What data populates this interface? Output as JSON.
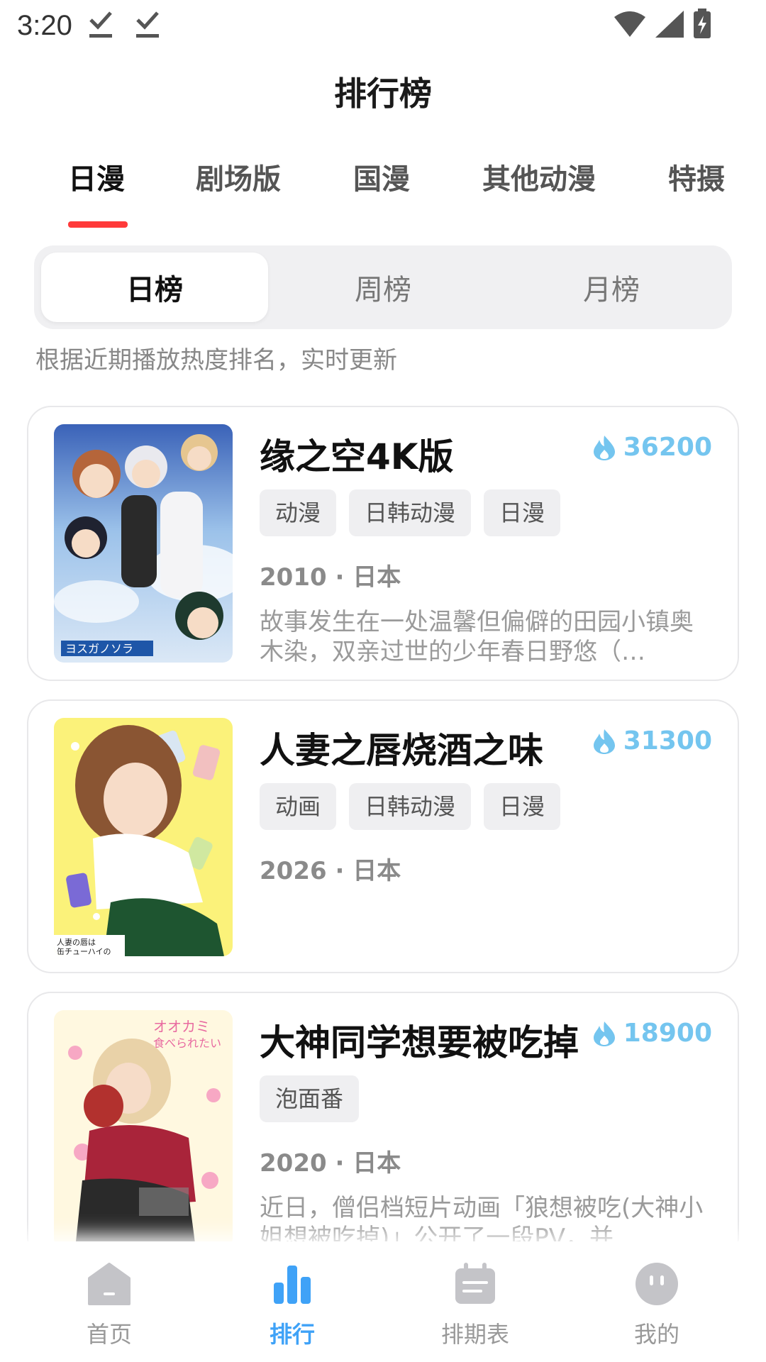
{
  "status_bar": {
    "time": "3:20"
  },
  "header": {
    "title": "排行榜"
  },
  "category_tabs": [
    {
      "label": "日漫",
      "active": true
    },
    {
      "label": "剧场版",
      "active": false
    },
    {
      "label": "国漫",
      "active": false
    },
    {
      "label": "其他动漫",
      "active": false
    },
    {
      "label": "特摄",
      "active": false
    }
  ],
  "period_tabs": [
    {
      "label": "日榜",
      "active": true
    },
    {
      "label": "周榜",
      "active": false
    },
    {
      "label": "月榜",
      "active": false
    }
  ],
  "hint": "根据近期播放热度排名，实时更新",
  "colors": {
    "accent": "#ff3a3a",
    "heat": "#74c5ef",
    "nav_active": "#3fa2f7"
  },
  "items": [
    {
      "title": "缘之空4K版",
      "heat": "36200",
      "tags": [
        "动漫",
        "日韩动漫",
        "日漫"
      ],
      "meta": "2010 · 日本",
      "description": "故事发生在一处温馨但偏僻的田园小镇奥木染，双亲过世的少年春日野悠（…"
    },
    {
      "title": "人妻之唇烧酒之味",
      "heat": "31300",
      "tags": [
        "动画",
        "日韩动漫",
        "日漫"
      ],
      "meta": "2026 · 日本",
      "description": ""
    },
    {
      "title": "大神同学想要被吃掉",
      "heat": "18900",
      "tags": [
        "泡面番"
      ],
      "meta": "2020 · 日本",
      "description": "近日，僧侣档短片动画「狼想被吃(大神小姐想被吃掉)」公开了一段PV，并…"
    }
  ],
  "bottom_nav": [
    {
      "label": "首页",
      "icon": "home-icon",
      "active": false
    },
    {
      "label": "排行",
      "icon": "bar-chart-icon",
      "active": true
    },
    {
      "label": "排期表",
      "icon": "calendar-icon",
      "active": false
    },
    {
      "label": "我的",
      "icon": "profile-icon",
      "active": false
    }
  ]
}
